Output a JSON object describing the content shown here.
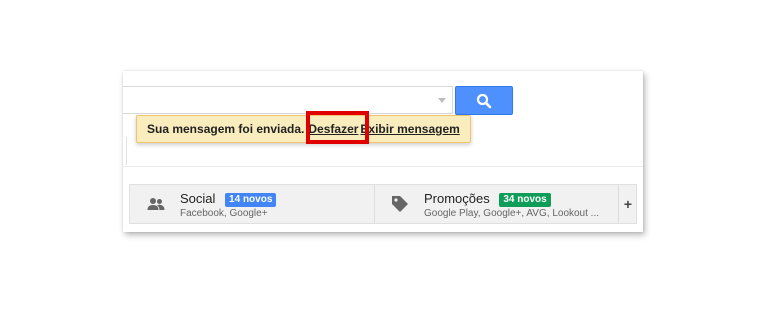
{
  "search": {
    "value": "",
    "placeholder": ""
  },
  "notice": {
    "message": "Sua mensagem foi enviada.",
    "undo_label": "Desfazer",
    "view_label": "Exibir mensagem"
  },
  "tabs": [
    {
      "title": "Social",
      "badge": "14 novos",
      "subtitle": "Facebook, Google+",
      "icon": "people-icon",
      "badge_color": "#4285f4"
    },
    {
      "title": "Promoções",
      "badge": "34 novos",
      "subtitle": "Google Play, Google+, AVG, Lookout ...",
      "icon": "tag-icon",
      "badge_color": "#0f9d58"
    }
  ],
  "add_tab_label": "+",
  "colors": {
    "search_button": "#4d90fe",
    "notice_background": "#f9edbe",
    "highlight": "#e00000"
  }
}
